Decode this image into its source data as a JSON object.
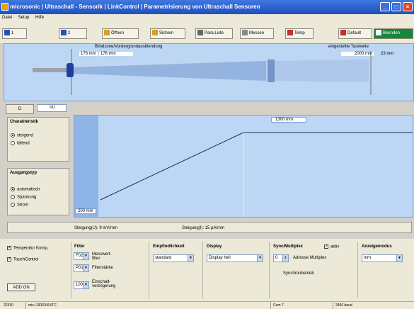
{
  "window": {
    "title": "microsonic | Ultraschall - Sensorik | LinkControl | Parametrisierung von Ultraschall Sensoren",
    "min": "_",
    "max": "□",
    "close": "×"
  },
  "menu": [
    "Datei",
    "Setup",
    "Hilfe"
  ],
  "toolbar": {
    "conn1": "1",
    "conn2": "2",
    "open": "Öffnen",
    "save": "Sichern",
    "paralist": "Para.Liste",
    "measure": "Messen",
    "temp": "Temp",
    "default": "Default",
    "exit": "Beenden"
  },
  "visualization": {
    "blind_zone_label": "Blindzone/Vordergrundausblendung",
    "blind_zone_value1": "176 mm",
    "blind_zone_value2": "176 mm",
    "teach_label": "eingestellte Tastweite",
    "teach_value": "2000 mm",
    "far_value": "23 mm"
  },
  "tabs": {
    "d": "D",
    "iu": "I/U"
  },
  "characteristic": {
    "title": "Charakteristik",
    "rising": "steigend",
    "falling": "fallend",
    "selected": "rising"
  },
  "output_type": {
    "title": "Ausgangstyp",
    "auto": "automatisch",
    "voltage": "Spannung",
    "current": "Strom",
    "selected": "auto"
  },
  "chart_data": {
    "type": "line",
    "x_points": [
      200,
      1300
    ],
    "label_low": "200 mm",
    "label_high": "1300 mm",
    "note": ""
  },
  "status_panel": {
    "slope_u": "Steigung(U): 9 mV/mm",
    "slope_i": "Steigung(I): 15 µA/mm"
  },
  "bottom": {
    "temp_comp": "Temperatur Komp.",
    "touch_control": "TouchControl",
    "add_on": "ADD ON",
    "filter_title": "Filter",
    "filter_value": "F02",
    "filter_label": "Messwert-filter",
    "strength_value": "P01",
    "strength_label": "Filterstärke",
    "delay_value": "100",
    "delay_label": "Einschalt-verzögerung",
    "sensitivity_title": "Empfindlichkeit",
    "sensitivity_value": "standard",
    "display_title": "Display",
    "display_value": "Display hell",
    "sync_title": "Sync/Multiplex",
    "sync_active": "aktiv",
    "address_value": "0",
    "address_label": "Adresse Multiplex",
    "sync_mode": "Synchronbetrieb",
    "unit_title": "Anzeigemodus",
    "unit_value": "mm"
  },
  "statusbar": {
    "id": "22330",
    "model": "mic+130/D/I/U/TC",
    "port": "Com 7",
    "baud": "2400 baud"
  }
}
